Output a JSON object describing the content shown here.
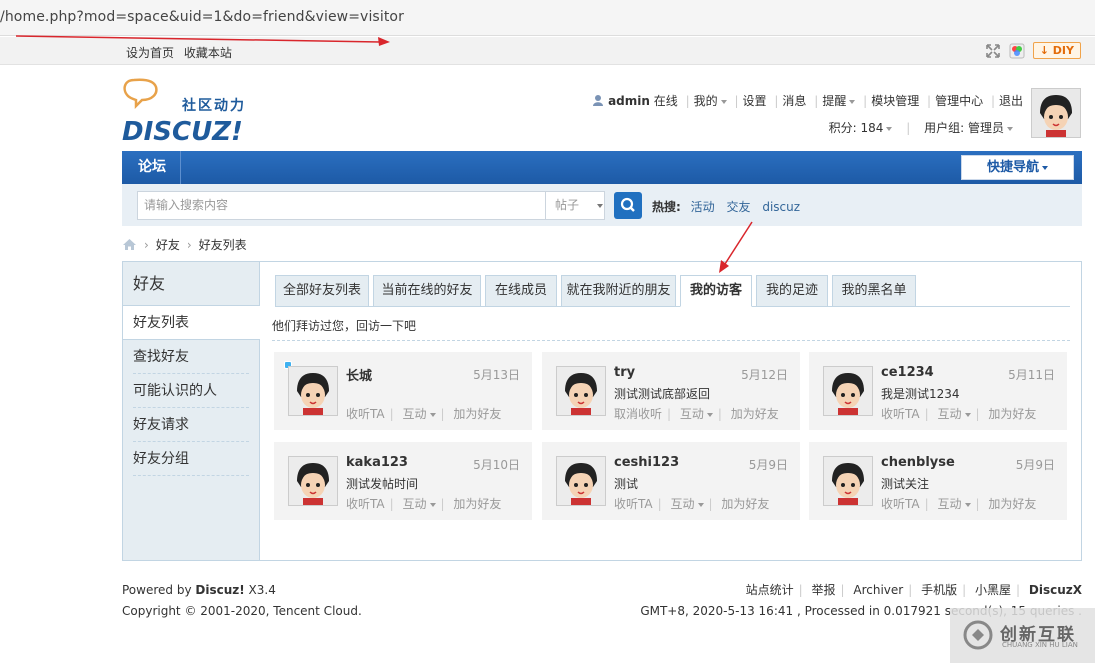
{
  "url": "/home.php?mod=space&uid=1&do=friend&view=visitor",
  "topbar": {
    "set_home": "设为首页",
    "bookmark": "收藏本站",
    "diy": "DIY"
  },
  "logo": {
    "slogan": "社区动力",
    "brand": "DISCUZ!"
  },
  "user": {
    "name": "admin",
    "status": "在线",
    "menu": [
      "我的",
      "设置",
      "消息",
      "提醒",
      "模块管理",
      "管理中心",
      "退出"
    ],
    "points_label": "积分: 184",
    "group_label": "用户组: 管理员"
  },
  "nav": {
    "forum": "论坛",
    "quick": "快捷导航"
  },
  "search": {
    "placeholder": "请输入搜索内容",
    "type": "帖子",
    "hot_label": "热搜:",
    "hot": [
      "活动",
      "交友",
      "discuz"
    ]
  },
  "breadcrumb": [
    "好友",
    "好友列表"
  ],
  "sidebar": {
    "title": "好友",
    "items": [
      "好友列表",
      "查找好友",
      "可能认识的人",
      "好友请求",
      "好友分组"
    ]
  },
  "tabs": [
    "全部好友列表",
    "当前在线的好友",
    "在线成员",
    "就在我附近的朋友",
    "我的访客",
    "我的足迹",
    "我的黑名单"
  ],
  "notice": "他们拜访过您，回访一下吧",
  "visitors": [
    {
      "name": "长城",
      "date": "5月13日",
      "desc": "",
      "follow": "收听TA",
      "interact": "互动",
      "add": "加为好友"
    },
    {
      "name": "try",
      "date": "5月12日",
      "desc": "测试测试底部返回",
      "follow": "取消收听",
      "interact": "互动",
      "add": "加为好友"
    },
    {
      "name": "ce1234",
      "date": "5月11日",
      "desc": "我是测试1234",
      "follow": "收听TA",
      "interact": "互动",
      "add": "加为好友"
    },
    {
      "name": "kaka123",
      "date": "5月10日",
      "desc": "测试发帖时间",
      "follow": "收听TA",
      "interact": "互动",
      "add": "加为好友"
    },
    {
      "name": "ceshi123",
      "date": "5月9日",
      "desc": "测试",
      "follow": "收听TA",
      "interact": "互动",
      "add": "加为好友"
    },
    {
      "name": "chenblyse",
      "date": "5月9日",
      "desc": "测试关注",
      "follow": "收听TA",
      "interact": "互动",
      "add": "加为好友"
    }
  ],
  "footer": {
    "powered_prefix": "Powered by ",
    "powered_brand": "Discuz!",
    "powered_version": " X3.4",
    "copyright": "Copyright © 2001-2020, Tencent Cloud.",
    "links": [
      "站点统计",
      "举报",
      "Archiver",
      "手机版",
      "小黑屋"
    ],
    "brand": "DiscuzX",
    "time": "GMT+8, 2020-5-13 16:41 , Processed in 0.017921 second(s), 15 queries ."
  },
  "watermark": {
    "title": "创新互联",
    "sub": "CHUANG XIN HU LIAN"
  },
  "colors": {
    "nav": "#1d5aa6",
    "link": "#336699",
    "sidebar": "#e5edf2",
    "border": "#c2d5e3",
    "annotation": "#d9262c"
  }
}
